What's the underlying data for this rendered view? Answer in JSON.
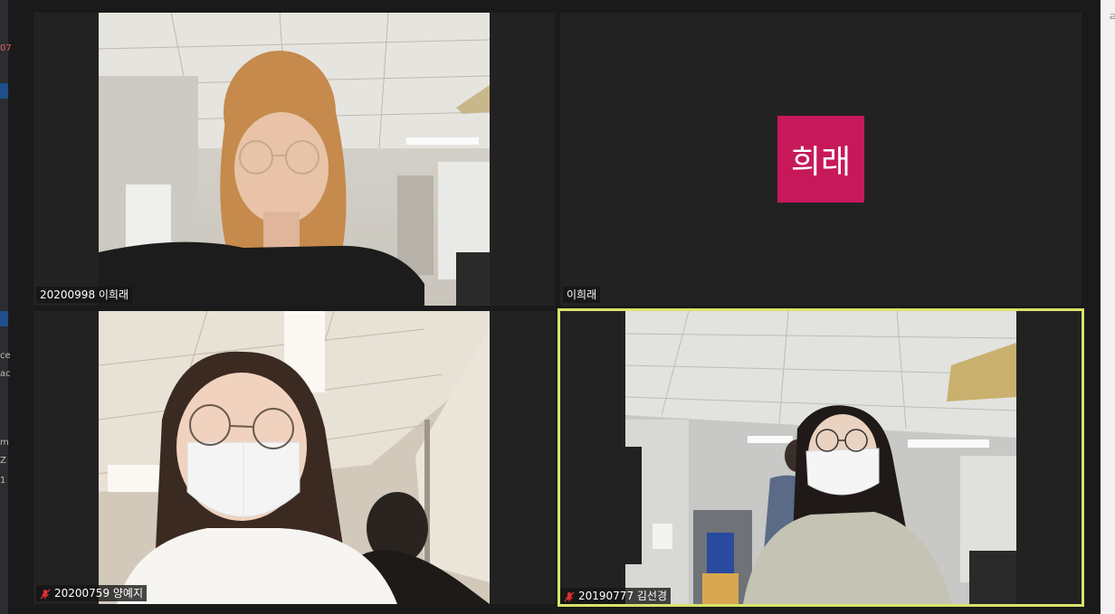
{
  "window": {
    "left_edge_fragments": [
      "07",
      "ce",
      "ac",
      "m",
      "Z",
      "1"
    ],
    "right_edge_fragment": "ㄹ"
  },
  "gallery": {
    "tiles": [
      {
        "name": "20200998 이희래",
        "video_on": true,
        "muted": false,
        "active_speaker": false
      },
      {
        "name": "이희래",
        "video_on": false,
        "muted": false,
        "active_speaker": false,
        "avatar_text": "희래",
        "avatar_color": "#c7195a"
      },
      {
        "name": "20200759 양예지",
        "video_on": true,
        "muted": true,
        "active_speaker": false
      },
      {
        "name": "20190777 김선경",
        "video_on": true,
        "muted": true,
        "active_speaker": true
      }
    ]
  },
  "colors": {
    "active_border": "#d9e36a",
    "tile_bg": "#222222",
    "muted_icon": "#e03030"
  }
}
